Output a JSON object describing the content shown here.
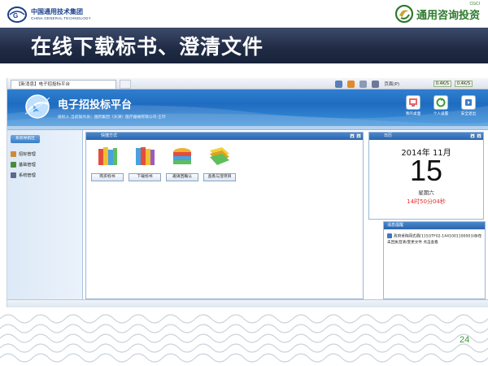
{
  "header": {
    "left_logo_cn": "中国通用技术集团",
    "left_logo_en": "CHINA GENERAL TECHNOLOGY",
    "right_logo_text": "通用咨询投资",
    "right_logo_small": "CGCI"
  },
  "slide_title": "在线下载标书、澄清文件",
  "page_number": "24",
  "browser": {
    "tab_title": "【新消息】电子招投标平台",
    "menu_page": "页面(P)",
    "speed_down": "0.4K/S",
    "speed_up": "0.4K/S"
  },
  "app": {
    "title": "电子招投标平台",
    "subtitle": "投标人  当前操作员：国药集团（天津）医疗器械有限公司-王玲",
    "buttons": [
      {
        "label": "我的桌面"
      },
      {
        "label": "个人设置"
      },
      {
        "label": "安全退出"
      }
    ]
  },
  "sidebar": {
    "heading": "系统导航区",
    "items": [
      {
        "label": "招标管理"
      },
      {
        "label": "基础管理"
      },
      {
        "label": "系统管理"
      }
    ]
  },
  "quick_panel": {
    "title": "快捷方式",
    "items": [
      {
        "label": "购买标书"
      },
      {
        "label": "下载标书"
      },
      {
        "label": "邀请回确认"
      },
      {
        "label": "查看与澄项目"
      }
    ]
  },
  "calendar": {
    "title": "日历",
    "year_month": "2014年 11月",
    "day": "15",
    "weekday": "星期六",
    "time": "14时50分04秒"
  },
  "messages": {
    "title": "消息提醒",
    "text": "政府采购网式费[115](TF02-1441001100003)存在未回执澄清/变更文件  点击查看"
  },
  "colors": {
    "title_bar": "#1f2a44",
    "app_blue": "#1f6cc0",
    "accent_green": "#2e7a2e",
    "clock_red": "#e03030"
  }
}
